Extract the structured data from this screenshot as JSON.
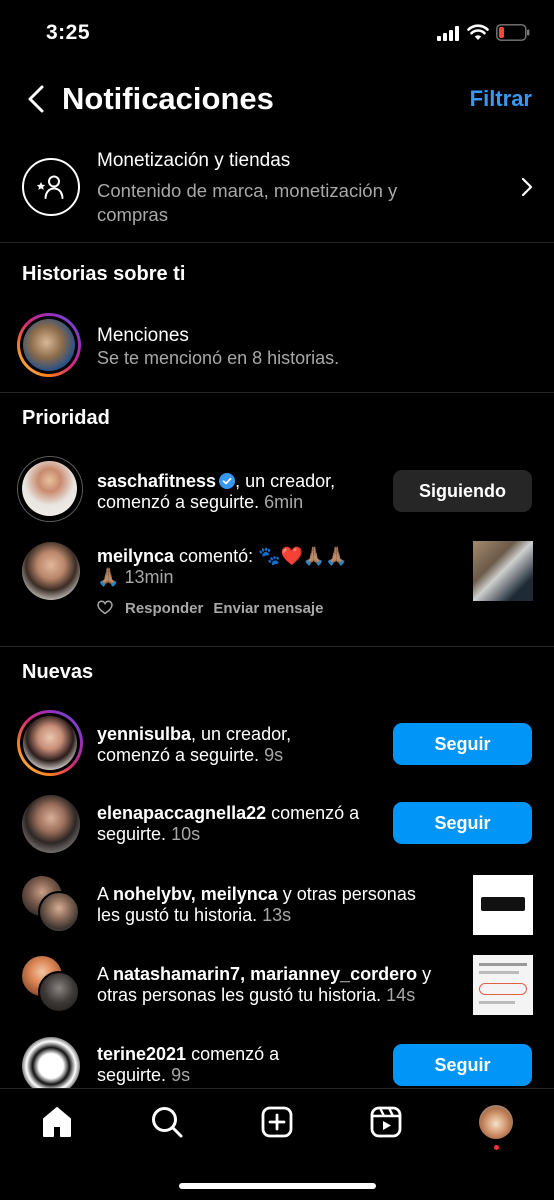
{
  "status_bar": {
    "time": "3:25"
  },
  "header": {
    "title": "Notificaciones",
    "filter_label": "Filtrar"
  },
  "monetization": {
    "title": "Monetización y tiendas",
    "subtitle": "Contenido de marca, monetización y compras"
  },
  "stories_section": {
    "title": "Historias sobre ti",
    "mentions_title": "Menciones",
    "mentions_sub": "Se te mencionó en 8 historias."
  },
  "priority_section": {
    "title": "Prioridad",
    "follow_notice": {
      "username": "saschafitness",
      "text_after": ", un creador,",
      "line2": "comenzó a seguirte.",
      "time": "6min",
      "button": "Siguiendo"
    },
    "comment_notice": {
      "username": "meilynca",
      "text_after": " comentó: 🐾❤️🙏🏽🙏🏽",
      "line2": "🙏🏽",
      "time": "13min",
      "reply_label": "Responder",
      "message_label": "Enviar mensaje"
    }
  },
  "new_section": {
    "title": "Nuevas",
    "items": [
      {
        "username": "yennisulba",
        "text_after": ", un creador,",
        "line2": "comenzó a seguirte.",
        "time": "9s",
        "button": "Seguir"
      },
      {
        "username": "elenapaccagnella22",
        "text_after": " comenzó a",
        "line2": "seguirte.",
        "time": "10s",
        "button": "Seguir"
      },
      {
        "prefix": "A ",
        "user1": "nohelybv",
        "sep": ", ",
        "user2": "meilynca",
        "text_after": " y otras personas",
        "line2": "les gustó tu historia.",
        "time": "13s"
      },
      {
        "prefix": "A ",
        "user1": "natashamarin7",
        "sep": ", ",
        "user2": "marianney_cordero",
        "text_after": " y",
        "line2": "otras personas les gustó tu historia.",
        "time": "14s"
      },
      {
        "username": "terine2021",
        "text_after": " comenzó a",
        "line2": "seguirte.",
        "time": "9s",
        "button": "Seguir"
      }
    ]
  },
  "colors": {
    "accent": "#0095f6",
    "link": "#3897f0",
    "background": "#000000"
  },
  "nav": [
    "home-icon",
    "search-icon",
    "create-icon",
    "reels-icon",
    "profile-avatar"
  ]
}
